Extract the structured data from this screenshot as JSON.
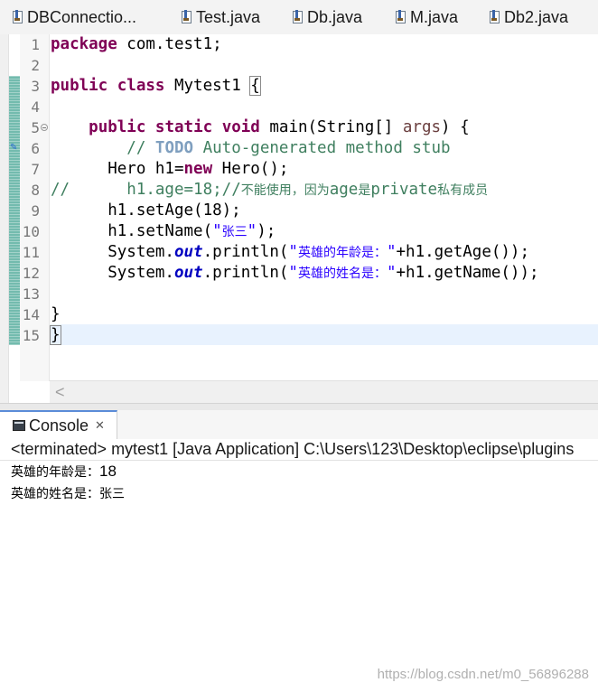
{
  "tabs": [
    {
      "label": "DBConnectio...",
      "icon": "java-file-icon"
    },
    {
      "label": "Test.java",
      "icon": "java-file-icon"
    },
    {
      "label": "Db.java",
      "icon": "java-file-icon"
    },
    {
      "label": "M.java",
      "icon": "java-file-icon"
    },
    {
      "label": "Db2.java",
      "icon": "java-file-icon"
    }
  ],
  "editor": {
    "line_numbers": [
      "1",
      "2",
      "3",
      "4",
      "5",
      "6",
      "7",
      "8",
      "9",
      "10",
      "11",
      "12",
      "13",
      "14",
      "15"
    ],
    "current_line": 15,
    "code": {
      "l1": {
        "kw": "package",
        "rest": " com.test1;"
      },
      "l3": {
        "kw1": "public",
        "kw2": "class",
        "name": " Mytest1 ",
        "brace": "{"
      },
      "l5": {
        "indent": "    ",
        "kw1": "public",
        "kw2": "static",
        "kw3": "void",
        "rest": " main(String[] ",
        "args": "args",
        "tail": ") {"
      },
      "l6": {
        "indent": "        ",
        "comment_start": "// ",
        "todo": "TODO",
        "comment_rest": " Auto-generated method stub"
      },
      "l7": {
        "indent": "      Hero h1=",
        "kw": "new",
        "rest": " Hero();"
      },
      "l8": {
        "prefix": "//",
        "code": "      h1.age=18;//",
        "cjk1": "不能使用，因为",
        "mid1": "age",
        "cjk2": "是",
        "mid2": "private",
        "cjk3": "私有成员"
      },
      "l9": {
        "text": "      h1.setAge(18);"
      },
      "l10": {
        "pre": "      h1.setName(",
        "quote_open": "\"",
        "cjk": "张三",
        "quote_close": "\"",
        "post": ");"
      },
      "l11": {
        "pre": "      System.",
        "field": "out",
        "mid": ".println(",
        "quote_open": "\"",
        "cjk": "英雄的年龄是：",
        "quote_close": "\"",
        "post": "+h1.getAge());"
      },
      "l12": {
        "pre": "      System.",
        "field": "out",
        "mid": ".println(",
        "quote_open": "\"",
        "cjk": "英雄的姓名是：",
        "quote_close": "\"",
        "post": "+h1.getName());"
      },
      "l14": {
        "text": "}"
      },
      "l15": {
        "text": "}"
      }
    },
    "scroll_left_arrow": "<"
  },
  "console": {
    "tab_label": "Console",
    "close_glyph": "✕",
    "status": "<terminated> mytest1 [Java Application] C:\\Users\\123\\Desktop\\eclipse\\plugins",
    "output": [
      {
        "label": "英雄的年龄是：",
        "value": "18"
      },
      {
        "label": "英雄的姓名是：",
        "value": "张三"
      }
    ]
  },
  "watermark": "https://blog.csdn.net/m0_56896288",
  "colors": {
    "keyword": "#7f0055",
    "comment": "#3f7f5f",
    "string": "#2a00ff",
    "field": "#0000c0",
    "current_line": "#e8f2fe",
    "change_ruler": "#5bb0a0"
  }
}
